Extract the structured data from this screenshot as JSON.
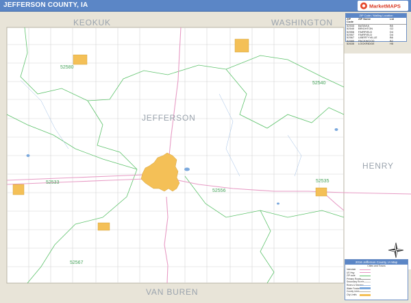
{
  "title": "JEFFERSON COUNTY, IA",
  "logo": {
    "text": "MarketMAPS",
    "icon": "logo-icon"
  },
  "colors": {
    "title_bar": "#5b86c6",
    "neighbor_fill": "#e8e4d8",
    "city_fill": "#f4c057",
    "zip_boundary": "#5cc26a",
    "highway": "#e79ac4",
    "road": "#c9c9c9",
    "water": "#7aa8dd"
  },
  "counties": {
    "north_west": "KEOKUK",
    "north_east": "WASHINGTON",
    "center": "JEFFERSON",
    "east": "HENRY",
    "south": "VAN BUREN"
  },
  "zip_labels": [
    "52580",
    "52540",
    "52533",
    "52556",
    "52535",
    "52567"
  ],
  "zip_table": {
    "title": "ZIP Code / Mailing Location",
    "headers": [
      "ZIP Code",
      "ZIP Name",
      "Lbl"
    ],
    "rows": [
      [
        "52533",
        "BATAVIA",
        "B5"
      ],
      [
        "52540",
        "BRIGHTON",
        "G2"
      ],
      [
        "52556",
        "FAIRFIELD",
        "D4"
      ],
      [
        "52557",
        "FAIRFIELD",
        "D4"
      ],
      [
        "52567",
        "LIBERTYVILLE",
        "B6"
      ],
      [
        "52580",
        "PACKWOOD",
        "B2"
      ],
      [
        "52635",
        "LOCKRIDGE",
        "H5"
      ]
    ]
  },
  "legend": {
    "title": "2016 Jefferson County, IA Map",
    "subtitle": "Cities and Towns",
    "rows": [
      {
        "label": "Interstate",
        "scale": ""
      },
      {
        "label": "US Hwy",
        "scale": ""
      },
      {
        "label": "ZIP code",
        "scale": ""
      },
      {
        "label": "Primary Roads",
        "scale": ""
      },
      {
        "label": "Secondary Roads",
        "scale": ""
      },
      {
        "label": "Rivers & Streams",
        "scale": ""
      },
      {
        "label": "Water Features",
        "scale": ""
      },
      {
        "label": "County Lines",
        "scale": ""
      },
      {
        "label": "City Limits",
        "scale": ""
      }
    ]
  },
  "compass_icon": "compass-rose-icon"
}
